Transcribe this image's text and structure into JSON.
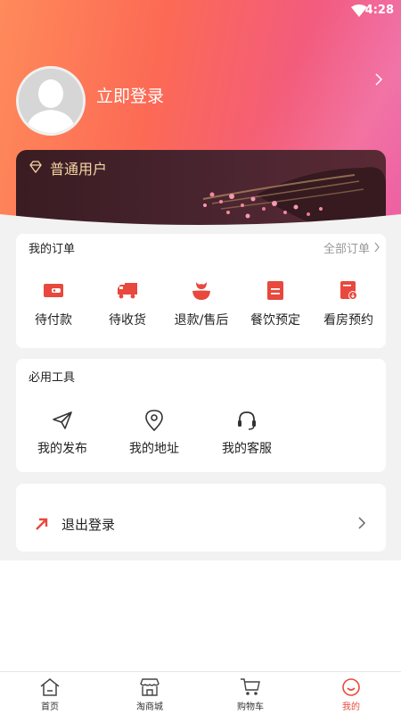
{
  "status_bar": {
    "time": "4:28"
  },
  "header": {
    "login_label": "立即登录"
  },
  "member_card": {
    "level_label": "普通用户"
  },
  "orders": {
    "title": "我的订单",
    "all_label": "全部订单",
    "items": [
      {
        "label": "待付款",
        "icon": "wallet-icon"
      },
      {
        "label": "待收货",
        "icon": "truck-icon"
      },
      {
        "label": "退款/售后",
        "icon": "refund-icon"
      },
      {
        "label": "餐饮预定",
        "icon": "dining-icon"
      },
      {
        "label": "看房预约",
        "icon": "house-booking-icon"
      }
    ]
  },
  "tools": {
    "title": "必用工具",
    "items": [
      {
        "label": "我的发布",
        "icon": "send-icon"
      },
      {
        "label": "我的地址",
        "icon": "location-icon"
      },
      {
        "label": "我的客服",
        "icon": "headset-icon"
      }
    ]
  },
  "logout": {
    "label": "退出登录"
  },
  "tabbar": {
    "items": [
      {
        "label": "首页",
        "icon": "home-icon"
      },
      {
        "label": "淘商城",
        "icon": "store-icon"
      },
      {
        "label": "购物车",
        "icon": "cart-icon"
      },
      {
        "label": "我的",
        "icon": "profile-icon",
        "active": true
      }
    ]
  },
  "colors": {
    "accent": "#e94b3c",
    "icon_red": "#e8483d",
    "gold": "#f5d6a4"
  }
}
